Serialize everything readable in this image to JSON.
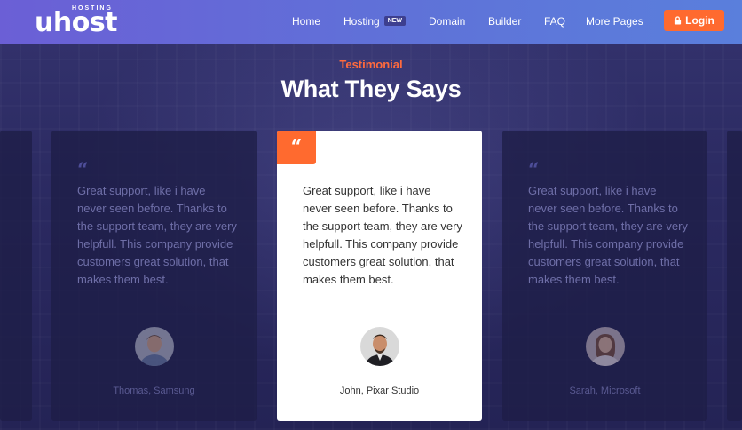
{
  "brand": {
    "small": "HOSTING",
    "name": "uhost"
  },
  "nav": {
    "items": [
      {
        "label": "Home"
      },
      {
        "label": "Hosting",
        "badge": "NEW"
      },
      {
        "label": "Domain"
      },
      {
        "label": "Builder"
      },
      {
        "label": "FAQ"
      },
      {
        "label": "More Pages"
      }
    ],
    "login_label": "Login"
  },
  "section": {
    "eyebrow": "Testimonial",
    "title": "What They Says"
  },
  "testimonials": [
    {
      "quote": "Great support, like i have never seen before. Thanks to the support team, they are very helpfull. This company provide customers great solution, that makes them best.",
      "author": "Thomas, Samsung"
    },
    {
      "quote": "Great support, like i have never seen before. Thanks to the support team, they are very helpfull. This company provide customers great solution, that makes them best.",
      "author": "John, Pixar Studio"
    },
    {
      "quote": "Great support, like i have never seen before. Thanks to the support team, they are very helpfull. This company provide customers great solution, that makes them best.",
      "author": "Sarah, Microsoft"
    }
  ],
  "colors": {
    "accent": "#ff6a2f",
    "header_start": "#6b5fd6",
    "header_end": "#5a7fdc",
    "background": "#2b2a5e"
  },
  "icons": {
    "quote": "quote-icon",
    "lock": "lock-icon"
  }
}
